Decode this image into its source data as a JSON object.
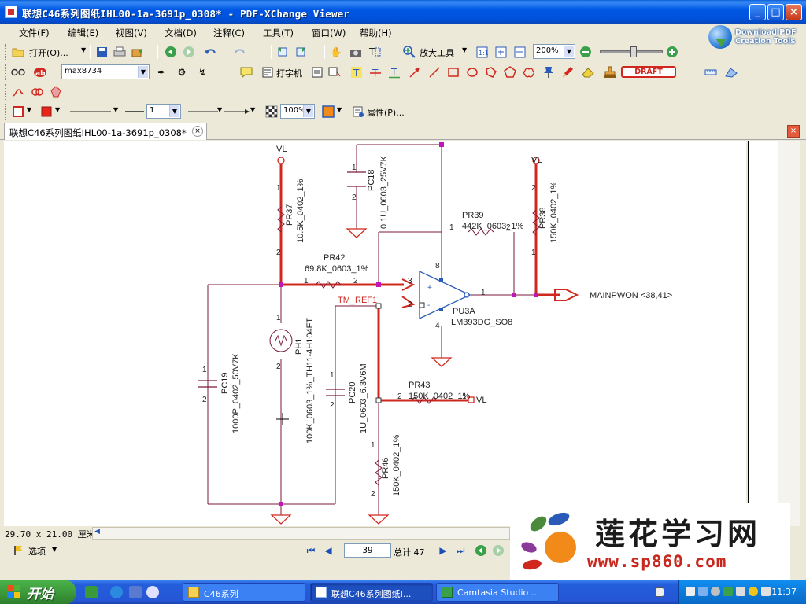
{
  "window": {
    "title": "联想C46系列图纸IHL00-1a-3691p_0308* - PDF-XChange Viewer",
    "buttons": {
      "minimize": "_",
      "maximize": "□",
      "close": "×"
    }
  },
  "menu": [
    "文件(F)",
    "编辑(E)",
    "视图(V)",
    "文档(D)",
    "注释(C)",
    "工具(T)",
    "窗口(W)",
    "帮助(H)"
  ],
  "brand": {
    "line1": "Download PDF",
    "line2": "Creation Tools"
  },
  "toolbar1": {
    "open_label": "打开(O)...",
    "zoom_tool_label": "放大工具",
    "zoom_value": "200%"
  },
  "toolbar2": {
    "font_name": "max8734",
    "typewriter_label": "打字机",
    "draft_stamp": "DRAFT"
  },
  "toolbar3": {
    "line_width": "1",
    "opacity": "100%",
    "properties_label": "属性(P)..."
  },
  "doc_tab": {
    "label": "联想C46系列图纸IHL00-1a-3691p_0308*"
  },
  "schematic": {
    "vl_left": "VL",
    "vl_right": "VL",
    "vl_pr43": "VL",
    "pc18_ref": "PC18",
    "pc18_val": "0.1U_0603_25V7K",
    "pr37_ref": "PR37",
    "pr37_val": "10.5K_0402_1%",
    "pr38_ref": "PR38",
    "pr38_val": "150K_0402_1%",
    "pr39_ref": "PR39",
    "pr39_val": "442K_0603_1%",
    "pr42_ref": "PR42",
    "pr42_val": "69.8K_0603_1%",
    "tm_ref": "TM_REF1",
    "pu3a_ref": "PU3A",
    "pu3a_val": "LM393DG_SO8",
    "mainpwon": "MAINPWON  <38,41>",
    "ph1_ref": "PH1",
    "ph1_val": "100K_0603_1%_TH11-4H104FT",
    "pc19_ref": "PC19",
    "pc19_val": "1000P_0402_50V7K",
    "pc20_ref": "PC20",
    "pc20_val": "1U_0603_6.3V6M",
    "pr43_ref": "PR43",
    "pr43_val": "150K_0402_1%",
    "pr46_ref": "PR46",
    "pr46_val": "150K_0402_1%"
  },
  "status": {
    "page_size": "29.70 x 21.00 厘米"
  },
  "nav": {
    "options_label": "选项",
    "current_page": "39",
    "total_label": "总计 47"
  },
  "watermark": {
    "title": "莲花学习网",
    "url": "www.sp860.com"
  },
  "taskbar": {
    "start_label": "开始",
    "tasks": [
      "C46系列",
      "联想C46系列图纸I...",
      "Camtasia Studio ..."
    ],
    "clock": "11:37"
  }
}
